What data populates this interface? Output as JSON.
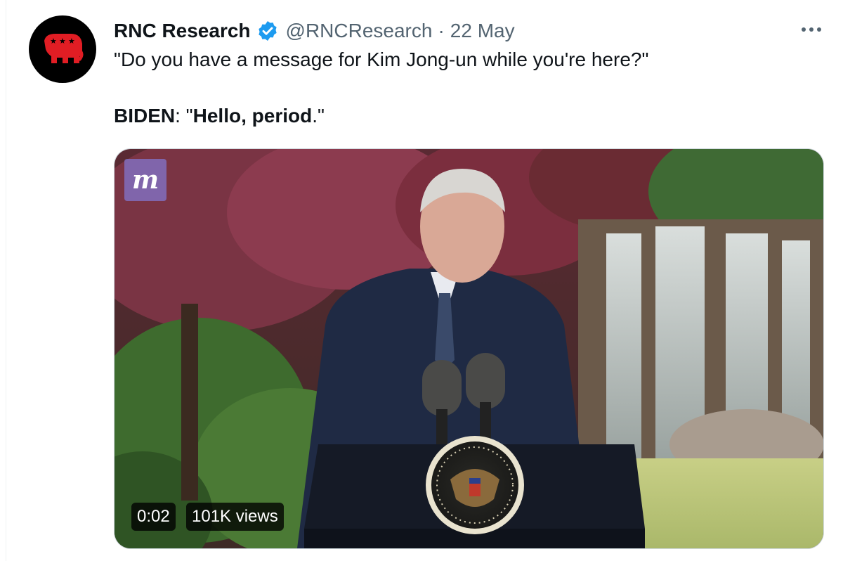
{
  "tweet": {
    "author_name": "RNC Research",
    "handle": "@RNCResearch",
    "separator": "·",
    "date": "22 May",
    "line1": "\"Do you have a message for Kim Jong-un while you're here?\"",
    "line2_speaker": "BIDEN",
    "line2_colon": ": \"",
    "line2_quote": "Hello, period",
    "line2_end": ".\""
  },
  "media": {
    "duration": "0:02",
    "views": "101K views",
    "logo_letter": "m"
  },
  "icons": {
    "avatar": "rnc-elephant-logo",
    "verified": "verified-badge-icon",
    "more": "more-options-icon"
  },
  "colors": {
    "verified_blue": "#1d9bf0",
    "rnc_red": "#e11d24",
    "secondary_text": "#536471"
  }
}
